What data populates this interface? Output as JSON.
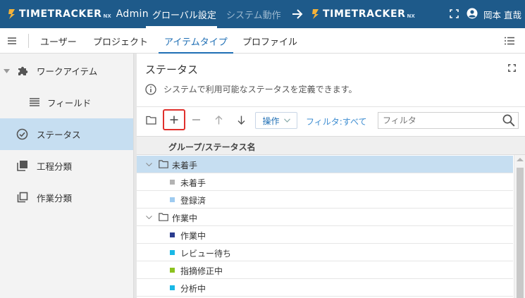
{
  "header": {
    "brand": "TIMETRACKER",
    "brand_suffix": "NX",
    "admin_label": "Admin",
    "nav": [
      {
        "label": "グローバル設定"
      },
      {
        "label": "システム動作"
      }
    ],
    "target_brand": "TIMETRACKER",
    "target_brand_suffix": "NX",
    "user_name": "岡本 直哉"
  },
  "subnav": {
    "tabs": [
      {
        "label": "ユーザー"
      },
      {
        "label": "プロジェクト"
      },
      {
        "label": "アイテムタイプ"
      },
      {
        "label": "プロファイル"
      }
    ],
    "active_tab": "アイテムタイプ"
  },
  "sidebar": {
    "items": [
      {
        "label": "ワークアイテム",
        "icon": "puzzle-icon"
      },
      {
        "label": "フィールド",
        "icon": "list-icon"
      },
      {
        "label": "ステータス",
        "icon": "check-circle-icon"
      },
      {
        "label": "工程分類",
        "icon": "layers-icon"
      },
      {
        "label": "作業分類",
        "icon": "copy-icon"
      }
    ],
    "active_item": "ステータス"
  },
  "main": {
    "title": "ステータス",
    "description": "システムで利用可能なステータスを定義できます。",
    "toolbar": {
      "operation_label": "操作",
      "filter_label": "フィルタ:すべて",
      "filter_placeholder": "フィルタ"
    },
    "table": {
      "column_header": "グループ/ステータス名",
      "groups": [
        {
          "name": "未着手",
          "statuses": [
            {
              "name": "未着手",
              "color": "#b3b3b3"
            },
            {
              "name": "登録済",
              "color": "#9ecbf0"
            }
          ]
        },
        {
          "name": "作業中",
          "statuses": [
            {
              "name": "作業中",
              "color": "#2b3c8f"
            },
            {
              "name": "レビュー待ち",
              "color": "#19b8e6"
            },
            {
              "name": "指摘修正中",
              "color": "#8cc21f"
            },
            {
              "name": "分析中",
              "color": "#19b8e6"
            }
          ]
        }
      ]
    }
  },
  "colors": {
    "header_bg": "#1e5a8a",
    "accent": "#1f6fb5",
    "selected_bg": "#c6def1",
    "highlight_box": "#e0302c"
  }
}
